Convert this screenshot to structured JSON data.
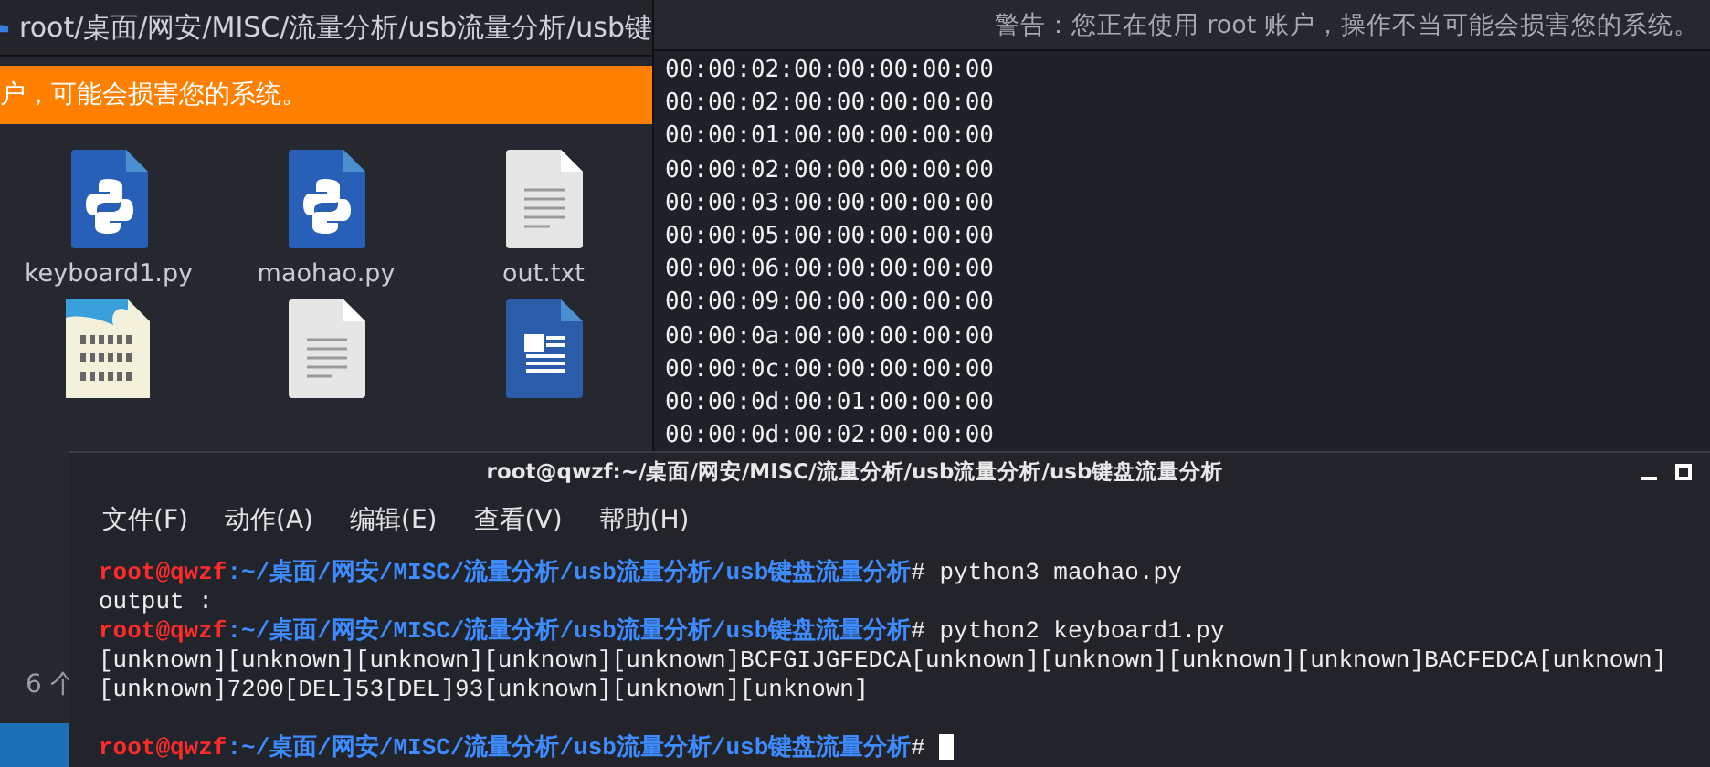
{
  "file_manager": {
    "path": "root/桌面/网安/MISC/流量分析/usb流量分析/usb键",
    "banner": "户，可能会损害您的系统。",
    "files": [
      {
        "name": "keyboard1.py",
        "kind": "python"
      },
      {
        "name": "maohao.py",
        "kind": "python"
      },
      {
        "name": "out.txt",
        "kind": "text"
      },
      {
        "kind": "binary"
      },
      {
        "kind": "text"
      },
      {
        "kind": "document"
      }
    ],
    "status": "6 个"
  },
  "data_viewer": {
    "warning": "警告：您正在使用 root 账户，操作不当可能会损害您的系统。",
    "lines": [
      "00:00:02:00:00:00:00:00",
      "00:00:02:00:00:00:00:00",
      "00:00:01:00:00:00:00:00",
      "00:00:02:00:00:00:00:00",
      "00:00:03:00:00:00:00:00",
      "00:00:05:00:00:00:00:00",
      "00:00:06:00:00:00:00:00",
      "00:00:09:00:00:00:00:00",
      "00:00:0a:00:00:00:00:00",
      "00:00:0c:00:00:00:00:00",
      "00:00:0d:00:01:00:00:00",
      "00:00:0d:00:02:00:00:00"
    ]
  },
  "terminal": {
    "title": "root@qwzf:~/桌面/网安/MISC/流量分析/usb流量分析/usb键盘流量分析",
    "menu": [
      "文件(F)",
      "动作(A)",
      "编辑(E)",
      "查看(V)",
      "帮助(H)"
    ],
    "lines": [
      {
        "kind": "prompt",
        "user": "root@qwzf",
        "path": ":~/桌面/网安/MISC/流量分析/usb流量分析/usb键盘流量分析",
        "command": "# python3 maohao.py",
        "cursor": false
      },
      {
        "kind": "output",
        "text": "output :"
      },
      {
        "kind": "prompt",
        "user": "root@qwzf",
        "path": ":~/桌面/网安/MISC/流量分析/usb流量分析/usb键盘流量分析",
        "command": "# python2 keyboard1.py",
        "cursor": false
      },
      {
        "kind": "output",
        "text": "[unknown][unknown][unknown][unknown][unknown]BCFGIJGFEDCA[unknown][unknown][unknown][unknown]BACFEDCA[unknown]"
      },
      {
        "kind": "output",
        "text": "[unknown]7200[DEL]53[DEL]93[unknown][unknown][unknown]"
      },
      {
        "kind": "prompt",
        "user": "root@qwzf",
        "path": ":~/桌面/网安/MISC/流量分析/usb流量分析/usb键盘流量分析",
        "command": "#",
        "cursor": true
      }
    ]
  }
}
